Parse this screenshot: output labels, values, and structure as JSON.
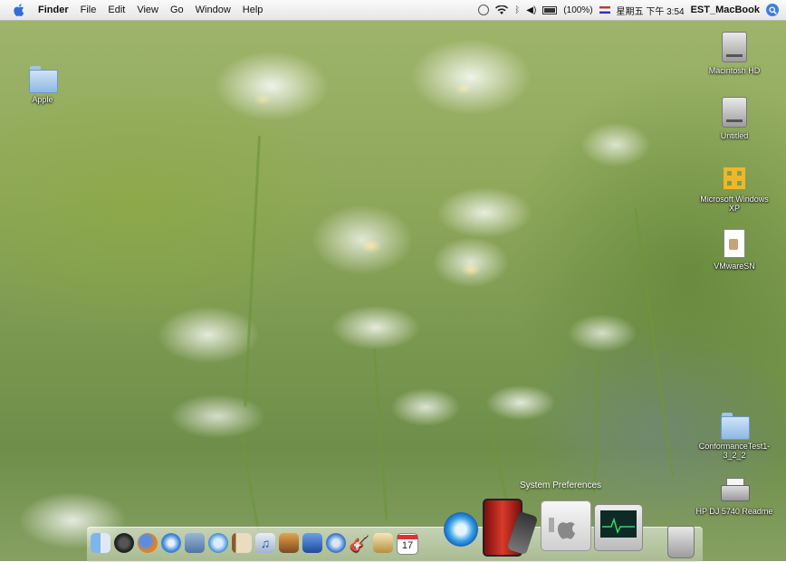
{
  "menubar": {
    "app_name": "Finder",
    "menus": [
      "File",
      "Edit",
      "View",
      "Go",
      "Window",
      "Help"
    ],
    "battery": "(100%)",
    "datetime": "星期五 下午 3:54",
    "computer_name": "EST_MacBook"
  },
  "desktop": {
    "icons": [
      {
        "label": "Apple"
      },
      {
        "label": "Macintosh HD"
      },
      {
        "label": "Untitled"
      },
      {
        "label": "Microsoft Windows XP"
      },
      {
        "label": "VMwareSN"
      },
      {
        "label": "ConformanceTest1-3_2_2"
      },
      {
        "label": "HP DJ 5740 Readme"
      }
    ]
  },
  "dock": {
    "tooltip": "System Preferences",
    "calendar_day": "17",
    "items": [
      "finder-icon",
      "dashboard-icon",
      "firefox-icon",
      "safari-icon",
      "mail-icon",
      "ichat-icon",
      "address-book-icon",
      "itunes-icon",
      "iphoto-icon",
      "imovie-icon",
      "idvd-icon",
      "garageband-icon",
      "preview-icon",
      "ical-icon",
      "quicktime-icon",
      "front-row-icon",
      "system-preferences-icon",
      "activity-monitor-icon",
      "trash-icon"
    ]
  }
}
